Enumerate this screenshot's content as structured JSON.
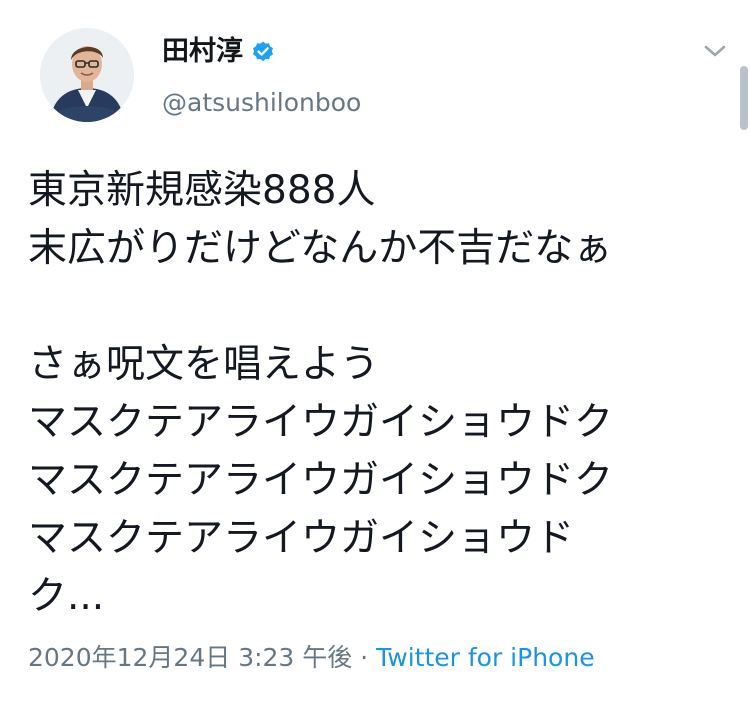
{
  "author": {
    "display_name": "田村淳",
    "handle": "@atsushilonboo",
    "verified": true,
    "avatar_icon": "profile-photo"
  },
  "tweet": {
    "lines": [
      "東京新規感染888人",
      "末広がりだけどなんか不吉だなぁ",
      "",
      "さぁ呪文を唱えよう",
      "マスクテアライウガイショウドク",
      "マスクテアライウガイショウドク",
      "マスクテアライウガイショウド",
      "ク..."
    ]
  },
  "meta": {
    "timestamp": "2020年12月24日 3:23 午後",
    "separator": " · ",
    "source": "Twitter for iPhone"
  },
  "colors": {
    "accent": "#1b95e0",
    "secondary_text": "#657786",
    "primary_text": "#141823"
  },
  "icons": {
    "verified": "verified-badge-icon",
    "more": "chevron-down-icon"
  }
}
